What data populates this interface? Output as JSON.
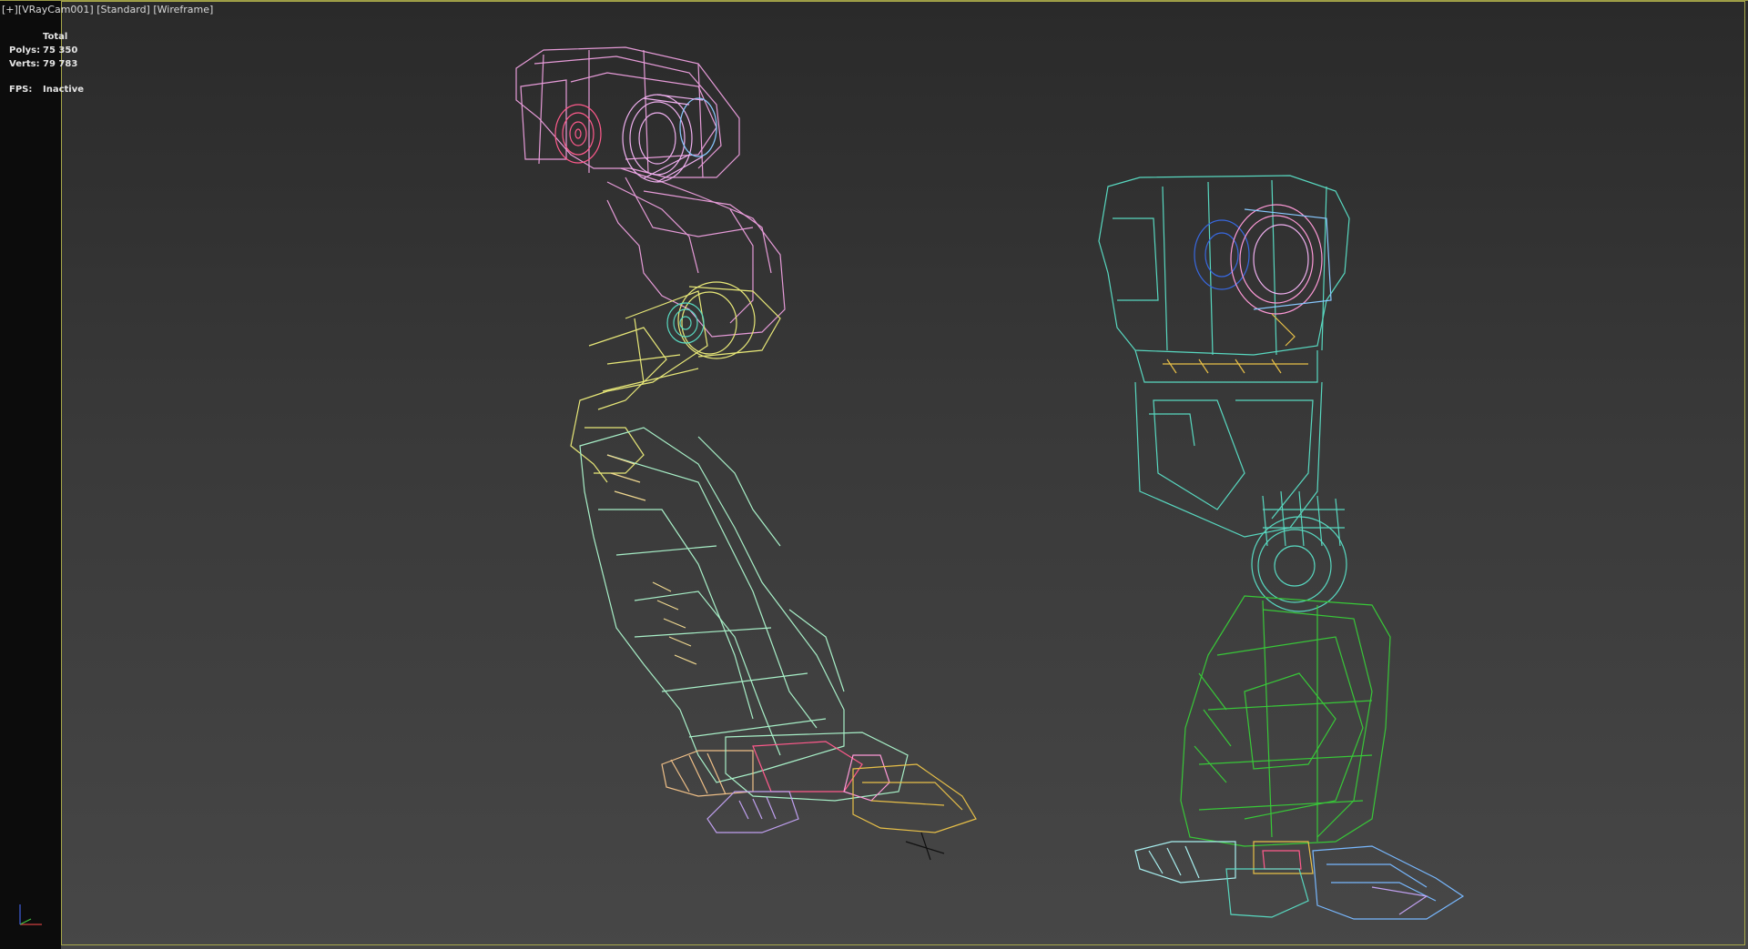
{
  "viewport": {
    "label_plus": "[+]",
    "label_camera": "[VRayCam001]",
    "label_shading": "[Standard]",
    "label_mode": "[Wireframe]"
  },
  "stats": {
    "header": "Total",
    "polys_label": "Polys:",
    "polys_value": "75 350",
    "verts_label": "Verts:",
    "verts_value": "79 783",
    "fps_label": "FPS:",
    "fps_value": "Inactive"
  },
  "gizmo": {
    "axes": [
      "x",
      "y",
      "z"
    ],
    "colors": {
      "x": "#d04040",
      "y": "#40c040",
      "z": "#4060e0"
    }
  },
  "scene": {
    "left_leg_colors": [
      "#e69bd8",
      "#e8e878",
      "#a8f0c8",
      "#f0c088",
      "#c0a0f0",
      "#e8c048",
      "#ff5a8c",
      "#88c8ff"
    ],
    "right_leg_colors": [
      "#58d8c0",
      "#38c838",
      "#a8f0f0",
      "#ff9ad8",
      "#3868e0",
      "#78b8ff",
      "#e8c048"
    ]
  }
}
